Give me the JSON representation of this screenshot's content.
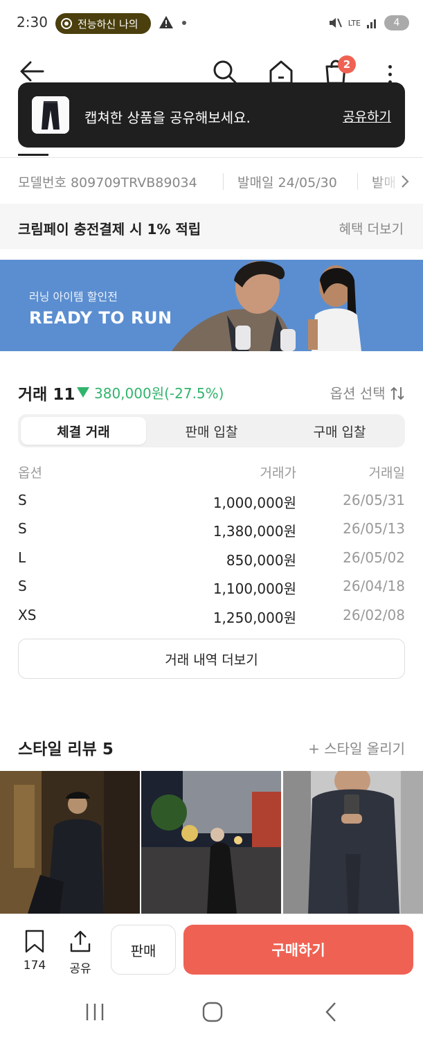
{
  "status": {
    "time": "2:30",
    "notification_pill": "전능하신 나의",
    "battery": "4",
    "network": "LTE"
  },
  "nav": {
    "cart_count": "2",
    "icons": [
      "back-arrow-icon",
      "search-icon",
      "home-icon",
      "shopping-bag-icon",
      "more-vert-icon"
    ]
  },
  "toast": {
    "message": "캡쳐한 상품을 공유해보세요.",
    "action": "공유하기"
  },
  "info_strip": {
    "model": "모델번호 809709TRVB89034",
    "release": "발매일 24/05/30",
    "extra": "발매"
  },
  "promo": {
    "text": "크림페이 충전결제 시 1% 적립",
    "link": "혜택 더보기"
  },
  "banner": {
    "subtitle": "러닝 아이템 할인전",
    "title": "READY TO RUN"
  },
  "trades": {
    "title": "거래 11",
    "change": "380,000원(-27.5%)",
    "change_color": "#31b46c",
    "option_select": "옵션 선택",
    "tabs": [
      "체결 거래",
      "판매 입찰",
      "구매 입찰"
    ],
    "headers": [
      "옵션",
      "거래가",
      "거래일"
    ],
    "rows": [
      {
        "option": "S",
        "price": "1,000,000원",
        "date": "26/05/31"
      },
      {
        "option": "S",
        "price": "1,380,000원",
        "date": "26/05/13"
      },
      {
        "option": "L",
        "price": "850,000원",
        "date": "26/05/02"
      },
      {
        "option": "S",
        "price": "1,100,000원",
        "date": "26/04/18"
      },
      {
        "option": "XS",
        "price": "1,250,000원",
        "date": "26/02/08"
      }
    ],
    "more": "거래 내역 더보기"
  },
  "style": {
    "title": "스타일 리뷰 5",
    "upload": "+ 스타일 올리기"
  },
  "bottom": {
    "bookmark_count": "174",
    "share": "공유",
    "sell": "판매",
    "buy": "구매하기",
    "accent": "#ef6253"
  }
}
